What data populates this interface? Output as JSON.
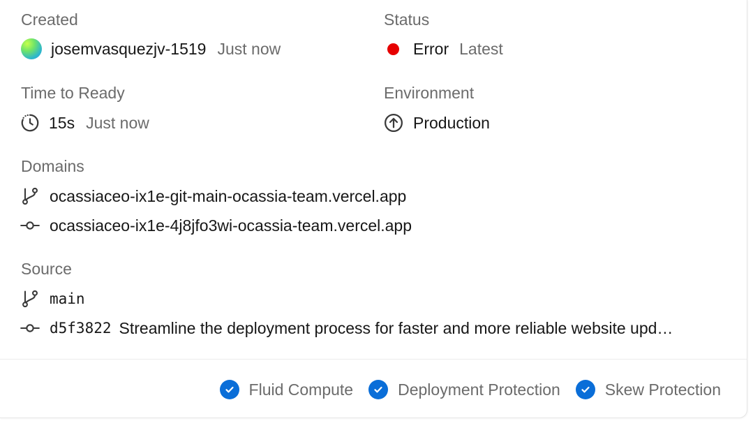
{
  "created": {
    "label": "Created",
    "user": "josemvasquezjv-1519",
    "time": "Just now"
  },
  "status": {
    "label": "Status",
    "value": "Error",
    "tag": "Latest",
    "color": "#e60000"
  },
  "time_to_ready": {
    "label": "Time to Ready",
    "value": "15s",
    "time": "Just now"
  },
  "environment": {
    "label": "Environment",
    "value": "Production"
  },
  "domains": {
    "label": "Domains",
    "items": [
      {
        "icon": "git-branch-icon",
        "text": "ocassiaceo-ix1e-git-main-ocassia-team.vercel.app"
      },
      {
        "icon": "git-commit-icon",
        "text": "ocassiaceo-ix1e-4j8jfo3wi-ocassia-team.vercel.app"
      }
    ]
  },
  "source": {
    "label": "Source",
    "branch": "main",
    "commit_hash": "d5f3822",
    "commit_message": "Streamline the deployment process for faster and more reliable website upd…"
  },
  "features": [
    {
      "icon": "check-circle-icon",
      "label": "Fluid Compute"
    },
    {
      "icon": "check-circle-icon",
      "label": "Deployment Protection"
    },
    {
      "icon": "check-circle-icon",
      "label": "Skew Protection"
    }
  ],
  "colors": {
    "accent": "#0a6ed8",
    "error": "#e60000",
    "muted": "#6b6b6b",
    "text": "#171717"
  }
}
